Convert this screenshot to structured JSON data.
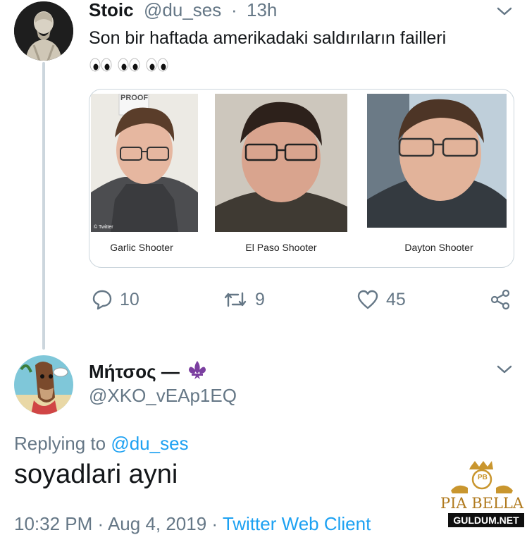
{
  "tweet": {
    "name": "Stoic",
    "handle": "@du_ses",
    "dot": "·",
    "time": "13h",
    "text": "Son bir haftada amerikadaki saldırıların failleri",
    "emoji_count": 3,
    "card": {
      "captions": [
        "Garlic Shooter",
        "El Paso Shooter",
        "Dayton Shooter"
      ],
      "photo_label": "PROOF",
      "twitter_credit": "© Twitter"
    },
    "actions": {
      "replies": "10",
      "retweets": "9",
      "likes": "45"
    }
  },
  "reply": {
    "name": "Μήτσος —",
    "handle": "@XKO_vEAp1EQ",
    "replying_prefix": "Replying to ",
    "replying_handle": "@du_ses",
    "text": "soyadlari ayni",
    "footer_time": "10:32 PM · Aug 4, 2019 · ",
    "footer_client": "Twitter Web Client"
  },
  "watermark": {
    "brand": "PIA BELLA",
    "sub": "GULDUM.NET",
    "monogram": "PB"
  },
  "colors": {
    "link": "#1da1f2",
    "secondary": "#657786",
    "fleur": "#7b3fa0"
  }
}
